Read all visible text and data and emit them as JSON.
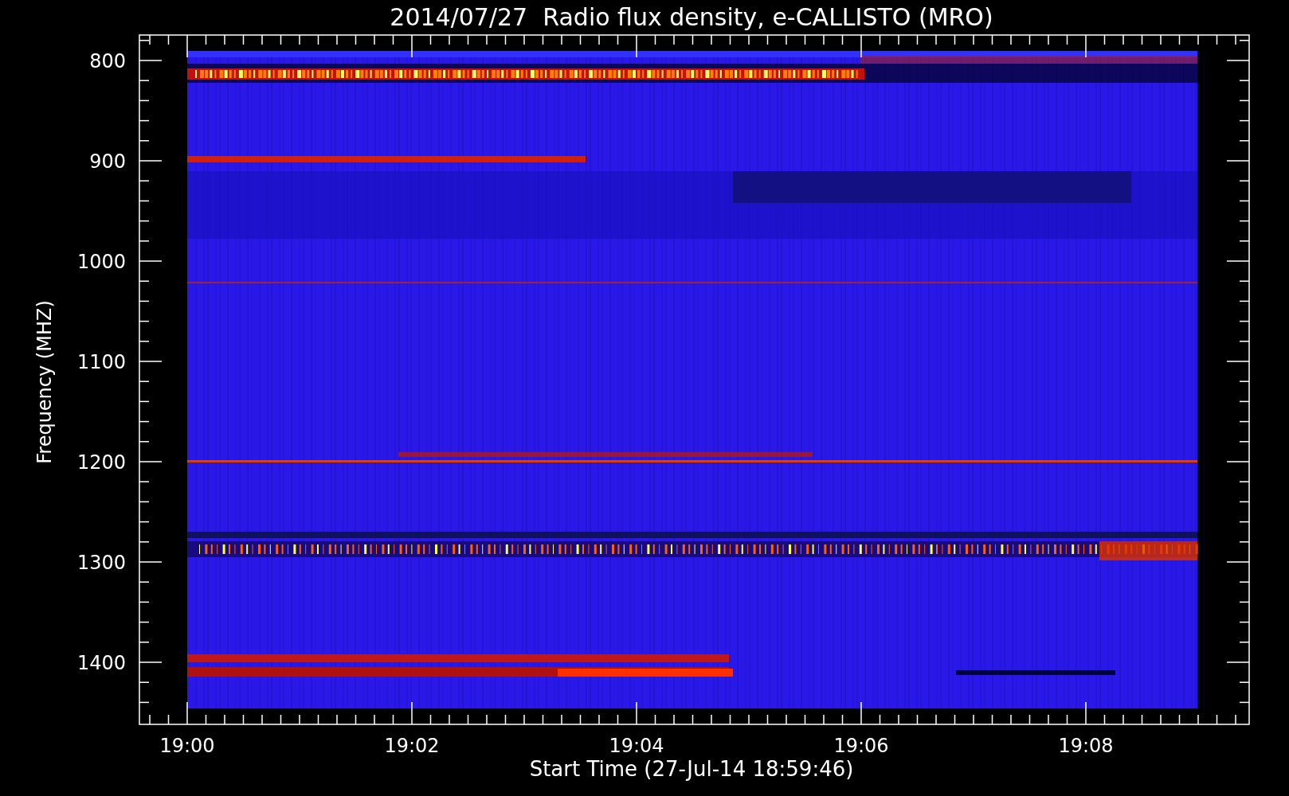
{
  "title": "2014/07/27  Radio flux density, e-CALLISTO (MRO)",
  "y_axis": {
    "label": "Frequency (MHZ)",
    "ticks": [
      "800",
      "900",
      "1000",
      "1100",
      "1200",
      "1300",
      "1400"
    ]
  },
  "x_axis": {
    "label": "Start Time (27-Jul-14 18:59:46)",
    "ticks": [
      "19:00",
      "19:02",
      "19:04",
      "19:06",
      "19:08"
    ]
  }
}
